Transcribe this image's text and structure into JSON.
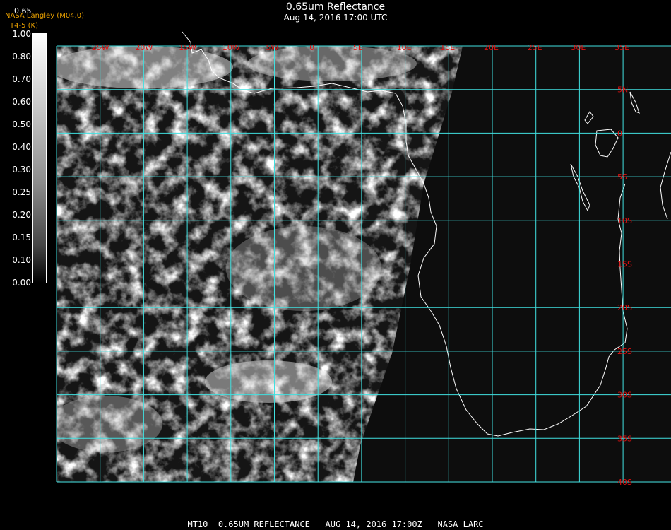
{
  "header": {
    "title": "0.65um Reflectance",
    "subtitle": "Aug 14, 2016 17:00 UTC",
    "pixel_value": "0.65",
    "product": "NASA Langley (M04.0)",
    "status": "T4-5 (K)"
  },
  "colorbar": {
    "labels": [
      "1.00",
      "0.80",
      "0.70",
      "0.60",
      "0.50",
      "0.40",
      "0.30",
      "0.25",
      "0.20",
      "0.15",
      "0.10",
      "0.00"
    ]
  },
  "map": {
    "grid_color": "#40e0e0",
    "label_color": "#e01010",
    "lon_labels": [
      "25W",
      "20W",
      "15W",
      "10W",
      "5W",
      "0",
      "5E",
      "10E",
      "15E",
      "20E",
      "25E",
      "30E",
      "35E"
    ],
    "lat_labels": [
      "5N",
      "0",
      "5S",
      "10S",
      "15S",
      "20S",
      "25S",
      "30S",
      "35S",
      "40S"
    ]
  },
  "footer": "MT10  0.65UM REFLECTANCE   AUG 14, 2016 17:00Z   NASA LARC"
}
